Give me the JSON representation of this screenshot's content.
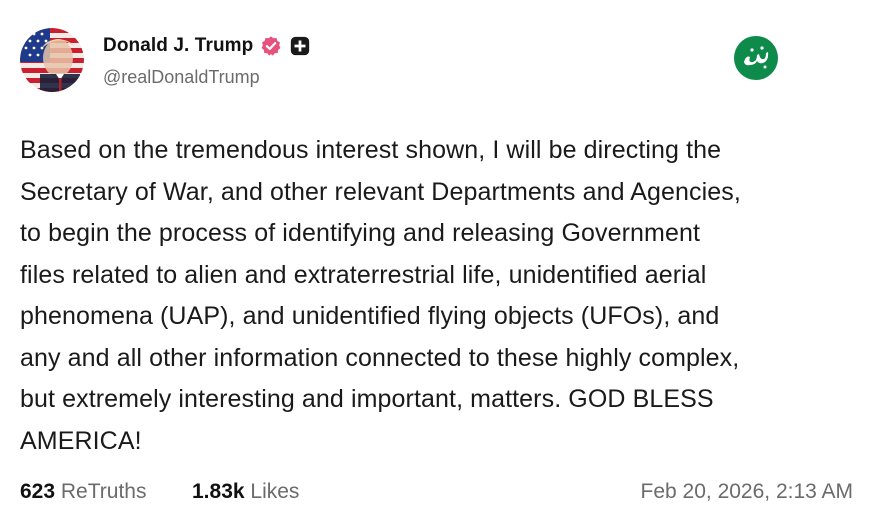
{
  "author": {
    "display_name": "Donald J. Trump",
    "handle": "@realDonaldTrump",
    "avatar_icon": "flag-portrait-avatar",
    "verified_icon": "verified-badge-icon",
    "verified_color": "#e5527d",
    "plus_icon": "plus-square-icon"
  },
  "watermark": {
    "icon": "green-circle-logo-icon",
    "color": "#0e8a4a"
  },
  "post": {
    "lines": [
      "Based on the tremendous interest shown, I will be directing the",
      "Secretary of War, and other relevant Departments and Agencies,",
      "to begin the process of identifying and releasing Government",
      "files related to alien and extraterrestrial life, unidentified aerial",
      "phenomena (UAP), and unidentified flying objects (UFOs), and",
      "any and all other information connected to these highly complex,",
      "but extremely interesting and important, matters. GOD BLESS",
      "AMERICA!"
    ]
  },
  "footer": {
    "retruths_count": "623",
    "retruths_label": "ReTruths",
    "likes_count": "1.83k",
    "likes_label": "Likes",
    "timestamp": "Feb 20, 2026, 2:13 AM"
  }
}
